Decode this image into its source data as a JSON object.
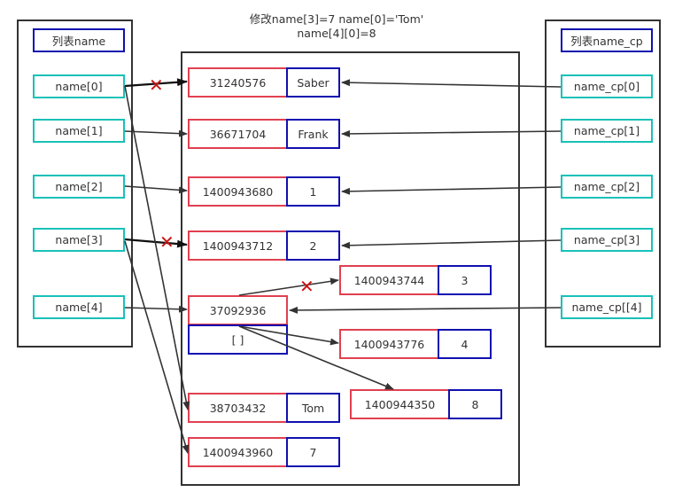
{
  "title": {
    "line1": "修改name[3]=7   name[0]='Tom'",
    "line2": "name[4][0]=8"
  },
  "left_list": {
    "header": "列表name",
    "items": [
      "name[0]",
      "name[1]",
      "name[2]",
      "name[3]",
      "name[4]"
    ]
  },
  "right_list": {
    "header": "列表name_cp",
    "items": [
      "name_cp[0]",
      "name_cp[1]",
      "name_cp[2]",
      "name_cp[3]",
      "name_cp[[4]"
    ]
  },
  "memory": {
    "cells": [
      {
        "addr": "31240576",
        "value": "Saber"
      },
      {
        "addr": "36671704",
        "value": "Frank"
      },
      {
        "addr": "1400943680",
        "value": "1"
      },
      {
        "addr": "1400943712",
        "value": "2"
      },
      {
        "addr": "1400943744",
        "value": "3"
      },
      {
        "addr": "37092936",
        "value": "[ ]"
      },
      {
        "addr": "1400943776",
        "value": "4"
      },
      {
        "addr": "38703432",
        "value": "Tom"
      },
      {
        "addr": "1400944350",
        "value": "8"
      },
      {
        "addr": "1400943960",
        "value": "7"
      }
    ]
  },
  "cut_mark": "X",
  "colors": {
    "list_item_border": "#19c1b8",
    "header_border": "#1010b0",
    "address_border": "#e04050",
    "value_border": "#1010b0",
    "cut_mark": "#c81414",
    "arrow": "#333333"
  }
}
